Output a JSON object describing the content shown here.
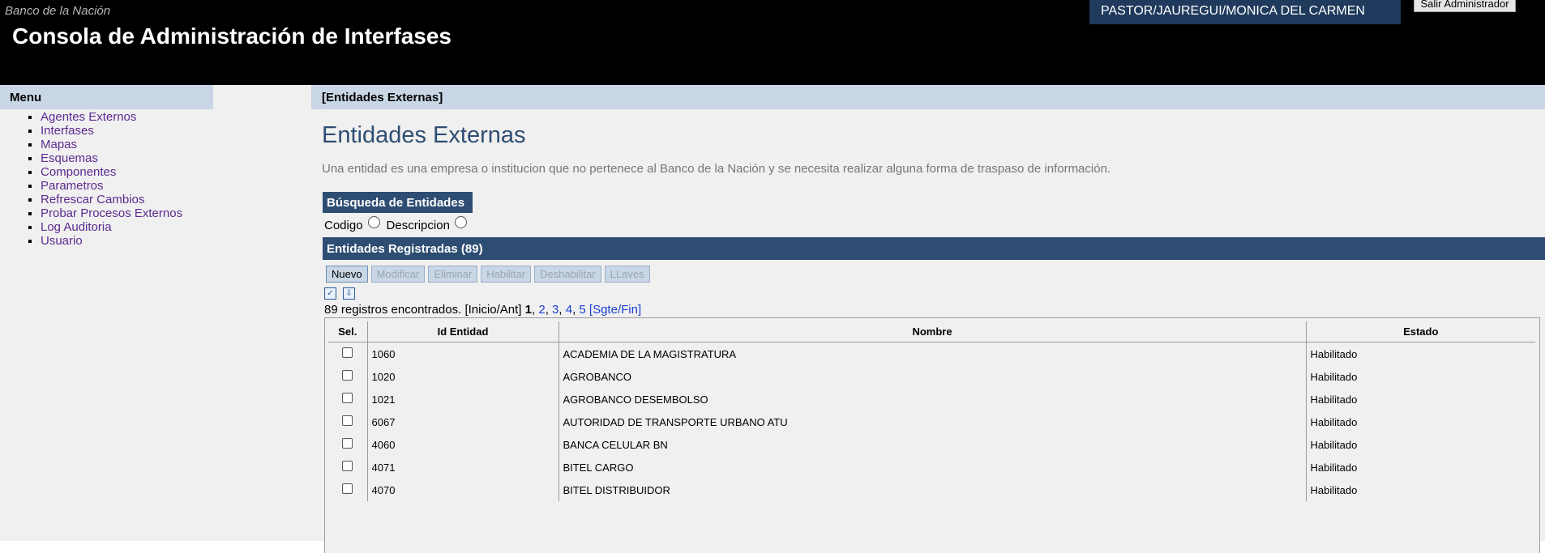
{
  "header": {
    "bank_name": "Banco de la Nación",
    "app_title": "Consola de Administración de Interfases",
    "user_name": "PASTOR/JAUREGUI/MONICA DEL CARMEN",
    "logout_label": "Salir Administrador"
  },
  "menu": {
    "title": "Menu",
    "items": [
      {
        "label": "Agentes Externos"
      },
      {
        "label": "Interfases"
      },
      {
        "label": "Mapas"
      },
      {
        "label": "Esquemas"
      },
      {
        "label": "Componentes"
      },
      {
        "label": "Parametros"
      },
      {
        "label": "Refrescar Cambios"
      },
      {
        "label": "Probar Procesos Externos"
      },
      {
        "label": "Log Auditoria"
      },
      {
        "label": "Usuario"
      }
    ]
  },
  "main": {
    "breadcrumb": "[Entidades Externas]",
    "title": "Entidades Externas",
    "description": "Una entidad es una empresa o institucion que no pertenece al Banco de la Nación y se necesita realizar alguna forma de traspaso de información.",
    "search": {
      "header": "Búsqueda de Entidades",
      "option_code": "Codigo",
      "option_description": "Descripcion"
    },
    "registered_header": "Entidades Registradas (89)",
    "buttons": {
      "new": "Nuevo",
      "modify": "Modificar",
      "delete": "Eliminar",
      "enable": "Habilitar",
      "disable": "Deshabilitar",
      "keys": "LLaves"
    },
    "pagination": {
      "count_text": "89 registros encontrados.",
      "first_prev": "[Inicio/Ant]",
      "current": "1",
      "pages": [
        "2",
        "3",
        "4",
        "5"
      ],
      "next_last": "[Sgte/Fin]"
    },
    "table": {
      "headers": {
        "sel": "Sel.",
        "id": "Id Entidad",
        "name": "Nombre",
        "status": "Estado"
      },
      "rows": [
        {
          "id": "1060",
          "name": "ACADEMIA DE LA MAGISTRATURA",
          "status": "Habilitado"
        },
        {
          "id": "1020",
          "name": "AGROBANCO",
          "status": "Habilitado"
        },
        {
          "id": "1021",
          "name": "AGROBANCO DESEMBOLSO",
          "status": "Habilitado"
        },
        {
          "id": "6067",
          "name": "AUTORIDAD DE TRANSPORTE URBANO ATU",
          "status": "Habilitado"
        },
        {
          "id": "4060",
          "name": "BANCA CELULAR BN",
          "status": "Habilitado"
        },
        {
          "id": "4071",
          "name": "BITEL CARGO",
          "status": "Habilitado"
        },
        {
          "id": "4070",
          "name": "BITEL DISTRIBUIDOR",
          "status": "Habilitado"
        }
      ]
    }
  }
}
